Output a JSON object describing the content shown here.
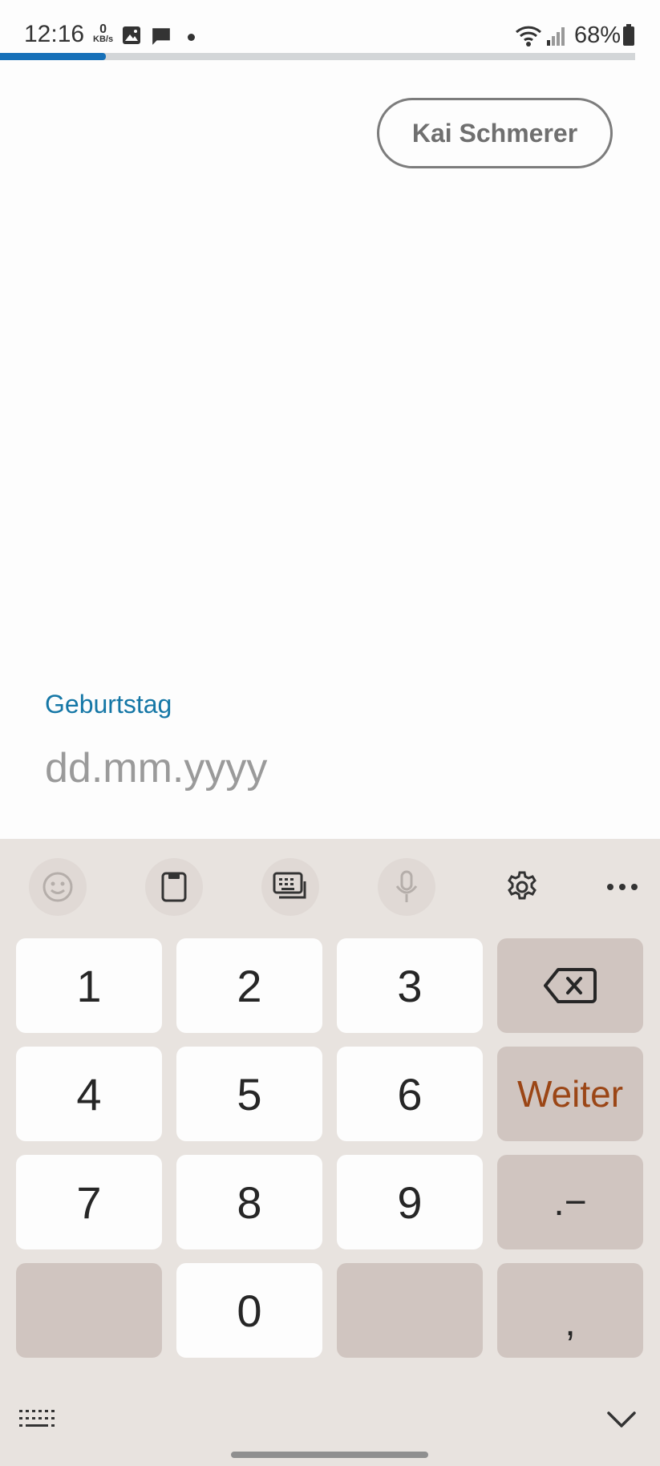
{
  "status_bar": {
    "time": "12:16",
    "net_speed_value": "0",
    "net_speed_unit": "KB/s",
    "battery": "68%",
    "icons": [
      "gallery-icon",
      "message-icon",
      "notification-dot",
      "wifi-icon",
      "signal-icon",
      "battery-icon"
    ]
  },
  "progress": {
    "percent": 16.7
  },
  "header": {
    "user_name": "Kai Schmerer"
  },
  "form": {
    "birthday_label": "Geburtstag",
    "birthday_value": "",
    "birthday_placeholder": "dd.mm.yyyy"
  },
  "keyboard": {
    "toolbar_icons": [
      "emoji-icon",
      "clipboard-icon",
      "keyboard-mode-icon",
      "microphone-icon",
      "settings-icon",
      "more-icon"
    ],
    "keys": {
      "k1": "1",
      "k2": "2",
      "k3": "3",
      "k4": "4",
      "k5": "5",
      "k6": "6",
      "k7": "7",
      "k8": "8",
      "k9": "9",
      "k0": "0",
      "next": "Weiter",
      "dot_dash": ".−",
      "comma": ","
    },
    "colors": {
      "next_text": "#9b4616",
      "accent": "#1577a6",
      "progress": "#1670b8"
    }
  }
}
